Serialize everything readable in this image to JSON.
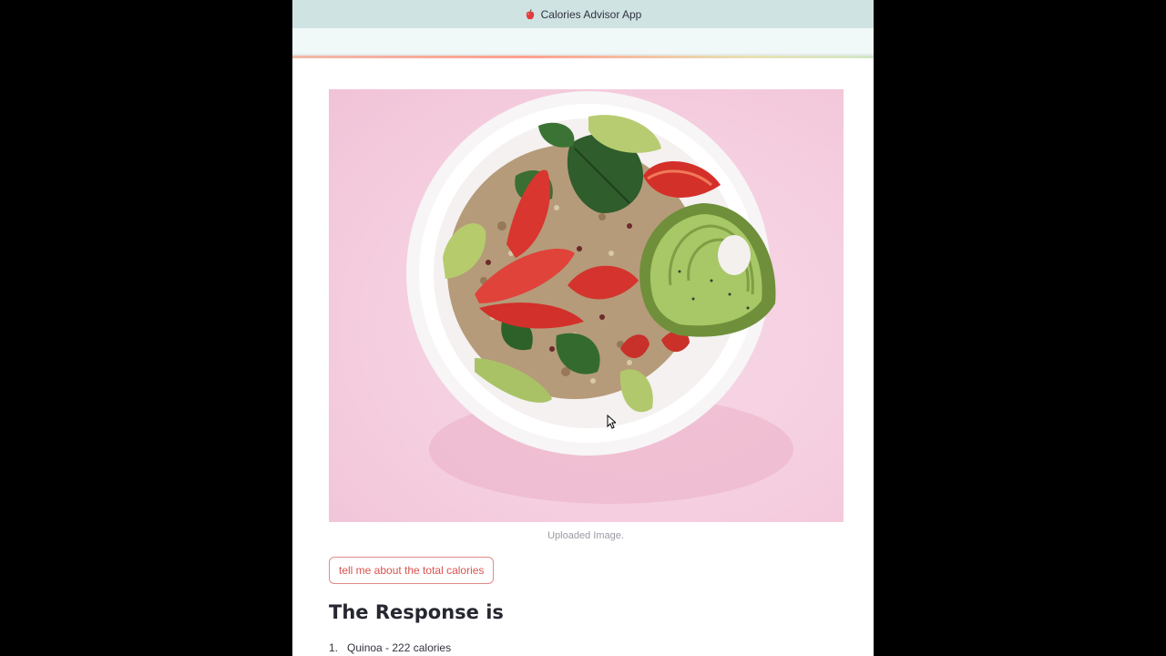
{
  "app": {
    "title": "Calories Advisor App",
    "icon": "apple-icon"
  },
  "image": {
    "caption": "Uploaded Image.",
    "subject": "salad-bowl-image"
  },
  "action": {
    "button_label": "tell me about the total calories"
  },
  "response": {
    "heading": "The Response is",
    "items": [
      {
        "number": "1.",
        "text": "Quinoa - 222 calories"
      }
    ]
  },
  "colors": {
    "accent": "#d9534f",
    "title_bar": "#cfe3e3",
    "image_background": "#f5cfe0"
  }
}
